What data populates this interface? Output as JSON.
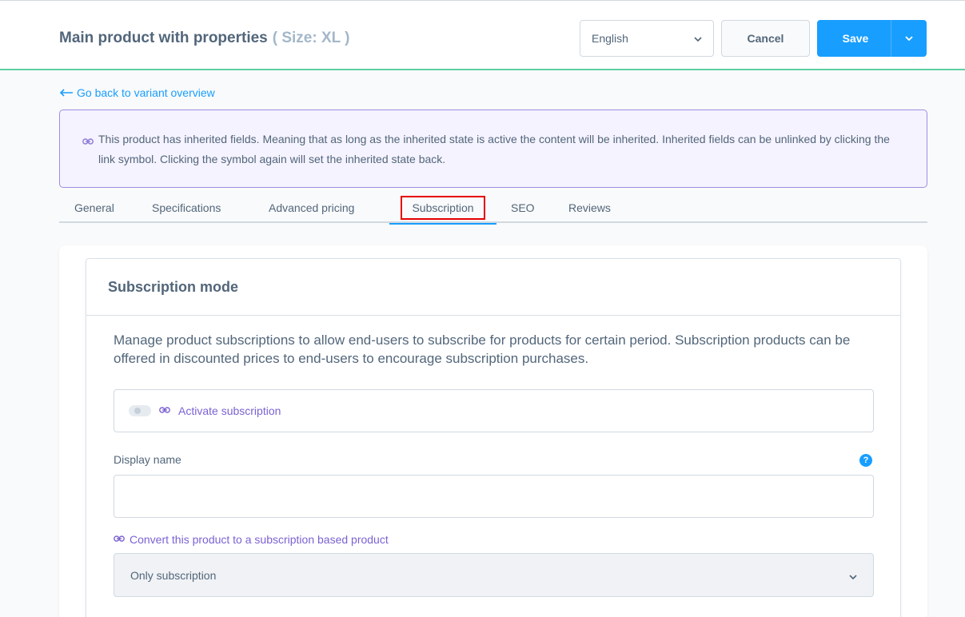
{
  "header": {
    "title": "Main product with properties",
    "variant": "( Size: XL )",
    "language": "English",
    "cancel_label": "Cancel",
    "save_label": "Save"
  },
  "back_link": "Go back to variant overview",
  "notice": "This product has inherited fields. Meaning that as long as the inherited state is active the content will be inherited. Inherited fields can be unlinked by clicking the link symbol. Clicking the symbol again will set the inherited state back.",
  "tabs": [
    {
      "label": "General"
    },
    {
      "label": "Specifications"
    },
    {
      "label": "Advanced pricing"
    },
    {
      "label": "Subscription",
      "active": true
    },
    {
      "label": "SEO"
    },
    {
      "label": "Reviews"
    }
  ],
  "card": {
    "title": "Subscription mode",
    "description": "Manage product subscriptions to allow end-users to subscribe for products for certain period. Subscription products can be offered in discounted prices to end-users to encourage subscription purchases.",
    "toggle_label": "Activate subscription",
    "toggle_on": false,
    "display_name_label": "Display name",
    "display_name_value": "",
    "help_glyph": "?",
    "convert_label": "Convert this product to a subscription based product",
    "convert_value": "Only subscription"
  },
  "colors": {
    "accent": "#189eff",
    "inherit": "#7c62d4",
    "topbar_border": "#5cd0a2",
    "highlight": "#e60000"
  }
}
